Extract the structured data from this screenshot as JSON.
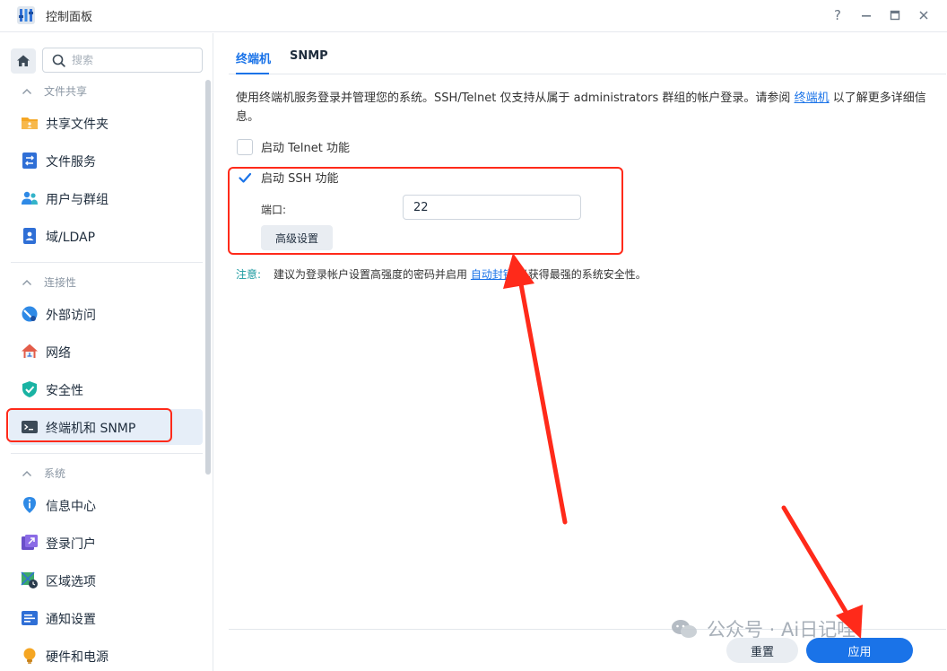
{
  "window": {
    "title": "控制面板",
    "controls": {
      "help": "?",
      "minimize": "—",
      "maximize": "▭",
      "close": "✕"
    }
  },
  "sidebar": {
    "search_placeholder": "搜索",
    "groups": [
      {
        "label": "文件共享",
        "items": [
          {
            "label": "共享文件夹",
            "icon": "shared-folder-icon"
          },
          {
            "label": "文件服务",
            "icon": "file-services-icon"
          },
          {
            "label": "用户与群组",
            "icon": "users-groups-icon"
          },
          {
            "label": "域/LDAP",
            "icon": "ldap-icon"
          }
        ]
      },
      {
        "label": "连接性",
        "items": [
          {
            "label": "外部访问",
            "icon": "external-access-icon"
          },
          {
            "label": "网络",
            "icon": "network-icon"
          },
          {
            "label": "安全性",
            "icon": "security-shield-icon"
          },
          {
            "label": "终端机和 SNMP",
            "icon": "terminal-icon",
            "active": true
          }
        ]
      },
      {
        "label": "系统",
        "items": [
          {
            "label": "信息中心",
            "icon": "info-icon"
          },
          {
            "label": "登录门户",
            "icon": "login-portal-icon"
          },
          {
            "label": "区域选项",
            "icon": "regional-options-icon"
          },
          {
            "label": "通知设置",
            "icon": "notification-icon"
          },
          {
            "label": "硬件和电源",
            "icon": "hardware-power-icon"
          }
        ]
      }
    ]
  },
  "tabs": [
    {
      "label": "终端机",
      "active": true
    },
    {
      "label": "SNMP",
      "active": false
    }
  ],
  "content": {
    "description_part1": "使用终端机服务登录并管理您的系统。SSH/Telnet 仅支持从属于 administrators 群组的帐户登录。请参阅 ",
    "description_link": "终端机",
    "description_part2": " 以了解更多详细信息。",
    "telnet_label": "启动 Telnet 功能",
    "telnet_checked": false,
    "ssh_label": "启动 SSH 功能",
    "ssh_checked": true,
    "port_label": "端口:",
    "port_value": "22",
    "advanced_button": "高级设置",
    "note_lead": "注意:",
    "note_part1": "建议为登录帐户设置高强度的密码并启用 ",
    "note_link": "自动封锁",
    "note_part2": " 以获得最强的系统安全性。"
  },
  "footer": {
    "reset_label": "重置",
    "apply_label": "应用"
  },
  "watermark": {
    "text": "公众号 · Ai日记哇"
  },
  "colors": {
    "accent": "#1a73e8",
    "annotation": "#ff2a1a",
    "active_bg": "#e6eef8"
  }
}
